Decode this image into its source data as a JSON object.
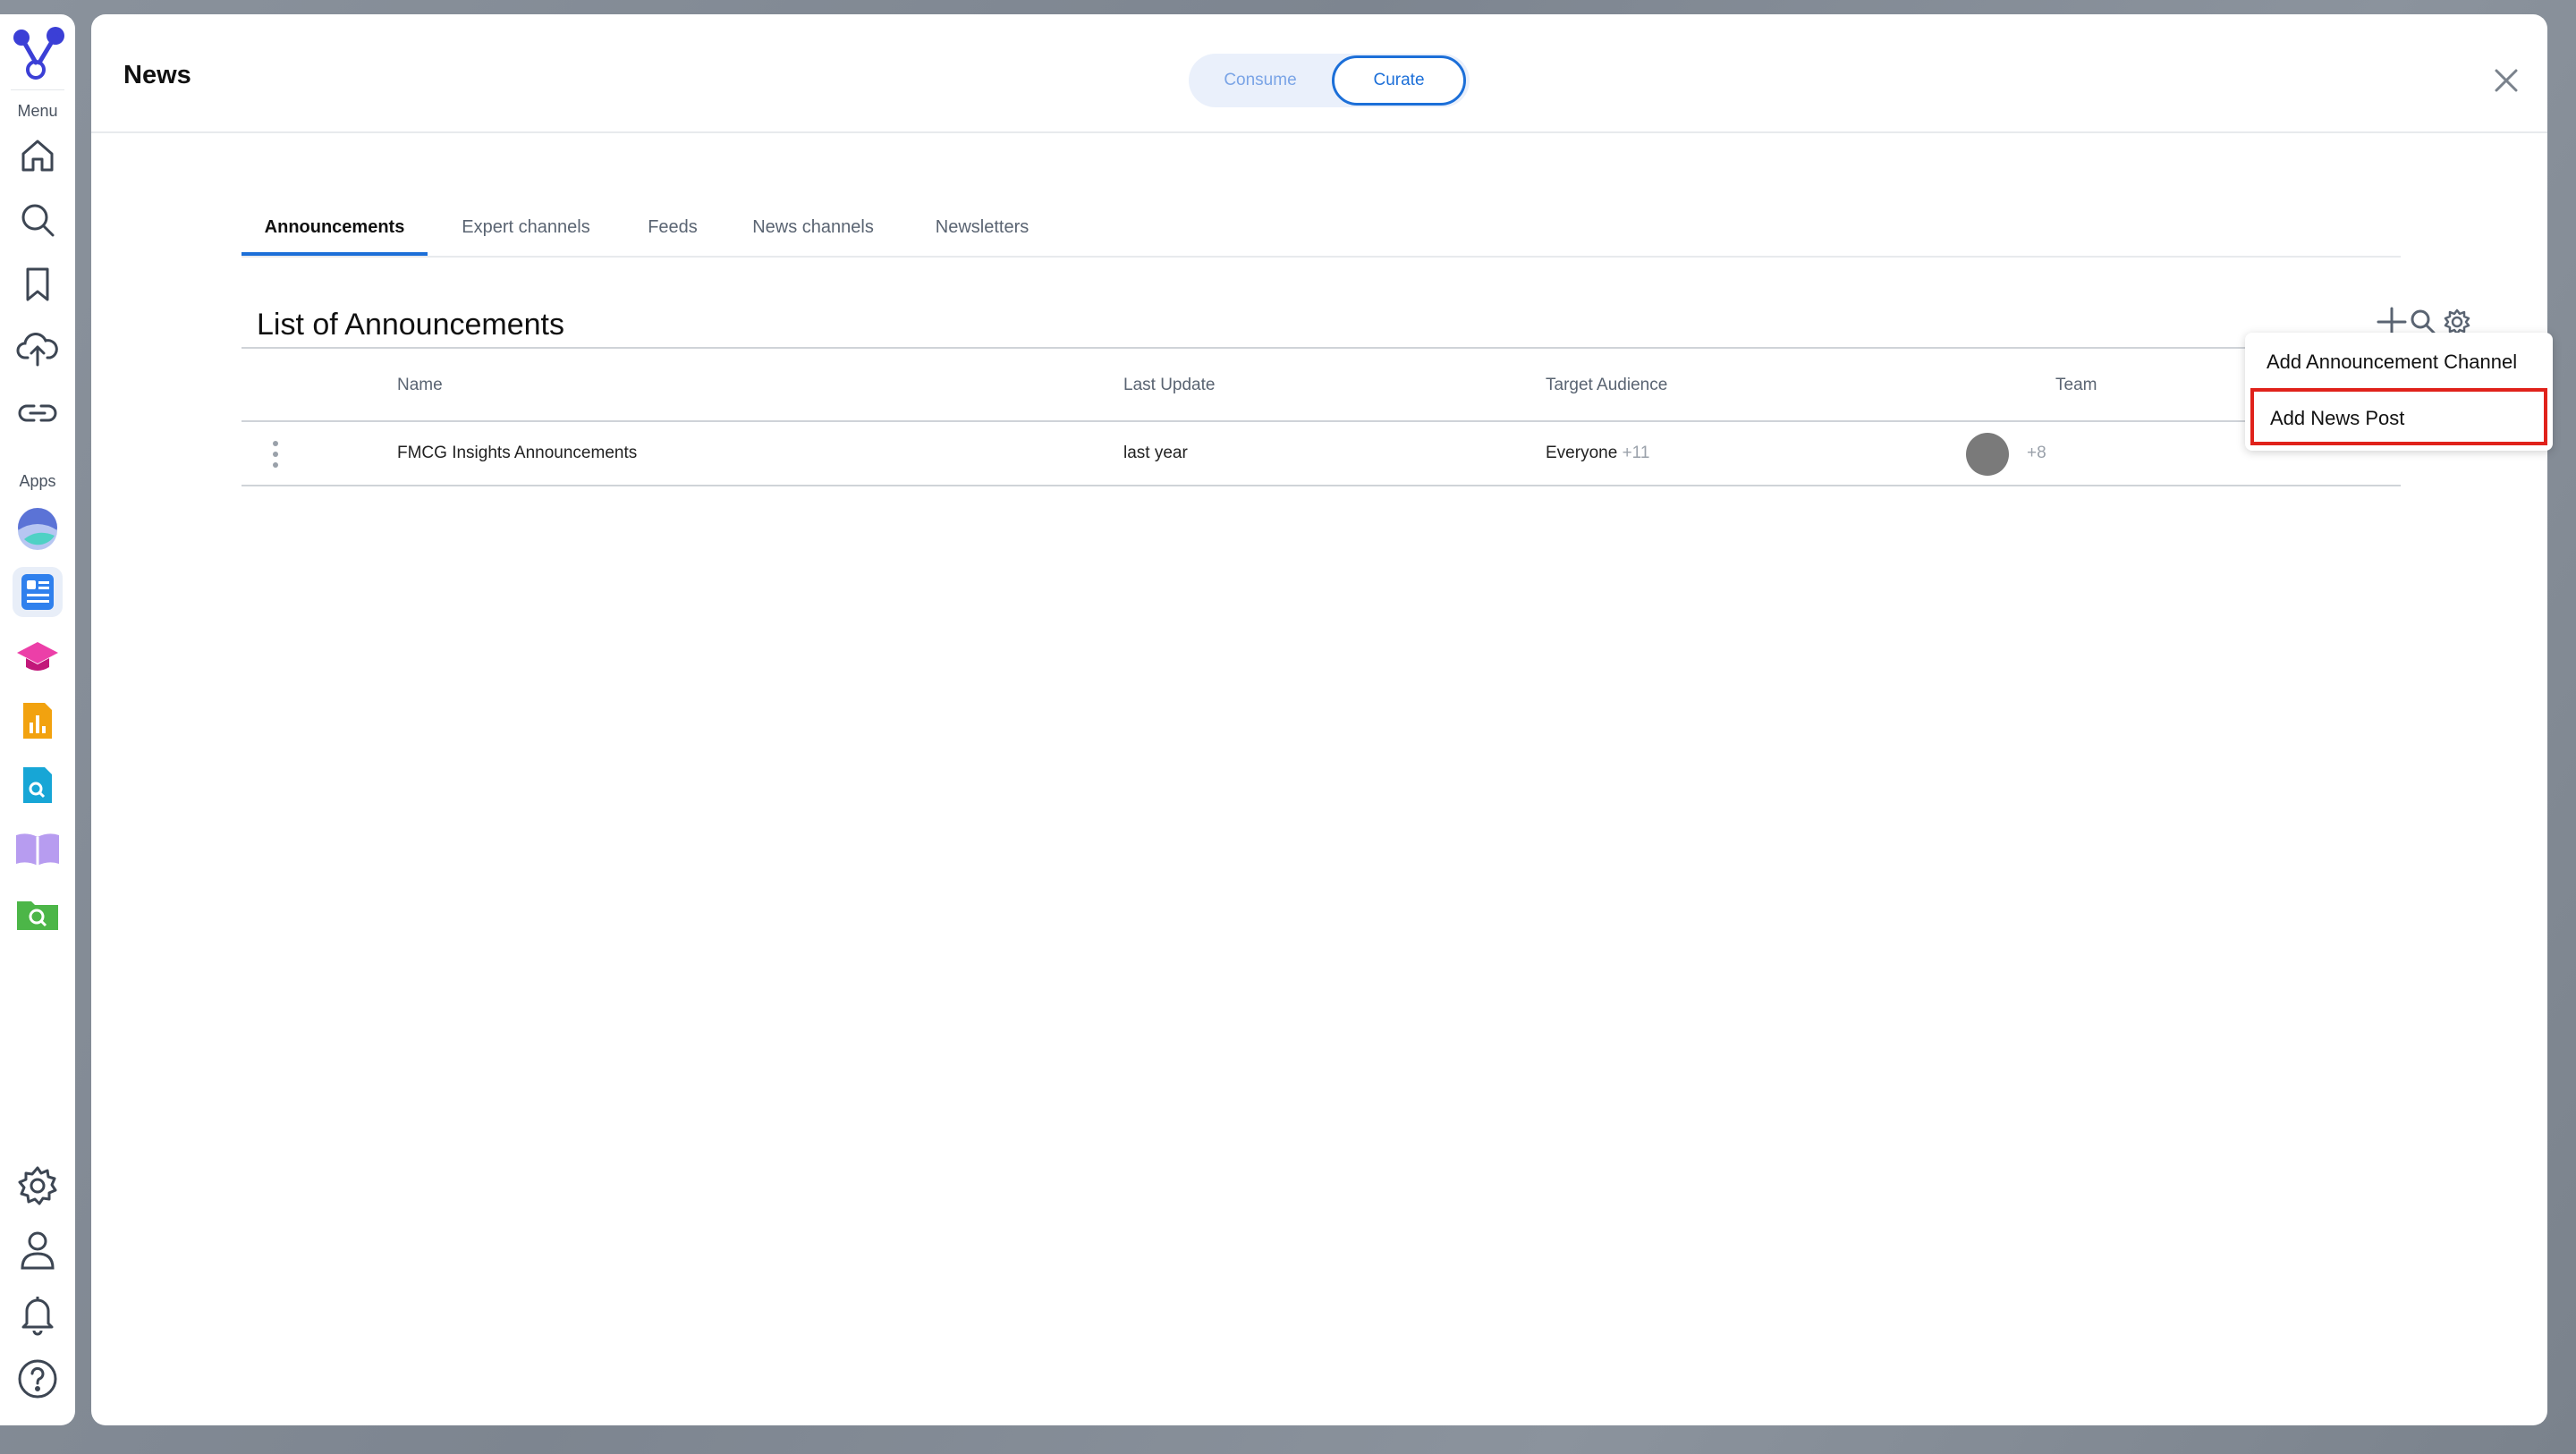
{
  "rail": {
    "menu_label": "Menu",
    "apps_label": "Apps",
    "menu_icons": [
      "home-icon",
      "search-icon",
      "bookmark-icon",
      "upload-cloud-icon",
      "link-icon"
    ],
    "app_icons": [
      "insights-app-icon",
      "news-app-icon",
      "learning-app-icon",
      "analytics-app-icon",
      "document-search-app-icon",
      "library-app-icon",
      "folder-search-app-icon"
    ],
    "bottom_icons": [
      "settings-icon",
      "user-icon",
      "bell-icon",
      "help-icon"
    ]
  },
  "header": {
    "title": "News",
    "mode_consume": "Consume",
    "mode_curate": "Curate",
    "active_mode": "Curate"
  },
  "tabs": [
    {
      "label": "Announcements",
      "active": true
    },
    {
      "label": "Expert channels",
      "active": false
    },
    {
      "label": "Feeds",
      "active": false
    },
    {
      "label": "News channels",
      "active": false
    },
    {
      "label": "Newsletters",
      "active": false
    }
  ],
  "section": {
    "title": "List of Announcements"
  },
  "table": {
    "columns": [
      "Name",
      "Last Update",
      "Target Audience",
      "Team"
    ],
    "rows": [
      {
        "name": "FMCG Insights Announcements",
        "last_update": "last year",
        "audience": "Everyone",
        "audience_more": "+11",
        "team_more": "+8"
      }
    ]
  },
  "dropdown": {
    "items": [
      "Add Announcement Channel",
      "Add News Post"
    ],
    "highlighted": "Add News Post"
  },
  "colors": {
    "accent": "#1c6fd8",
    "highlight": "#e0221b"
  }
}
